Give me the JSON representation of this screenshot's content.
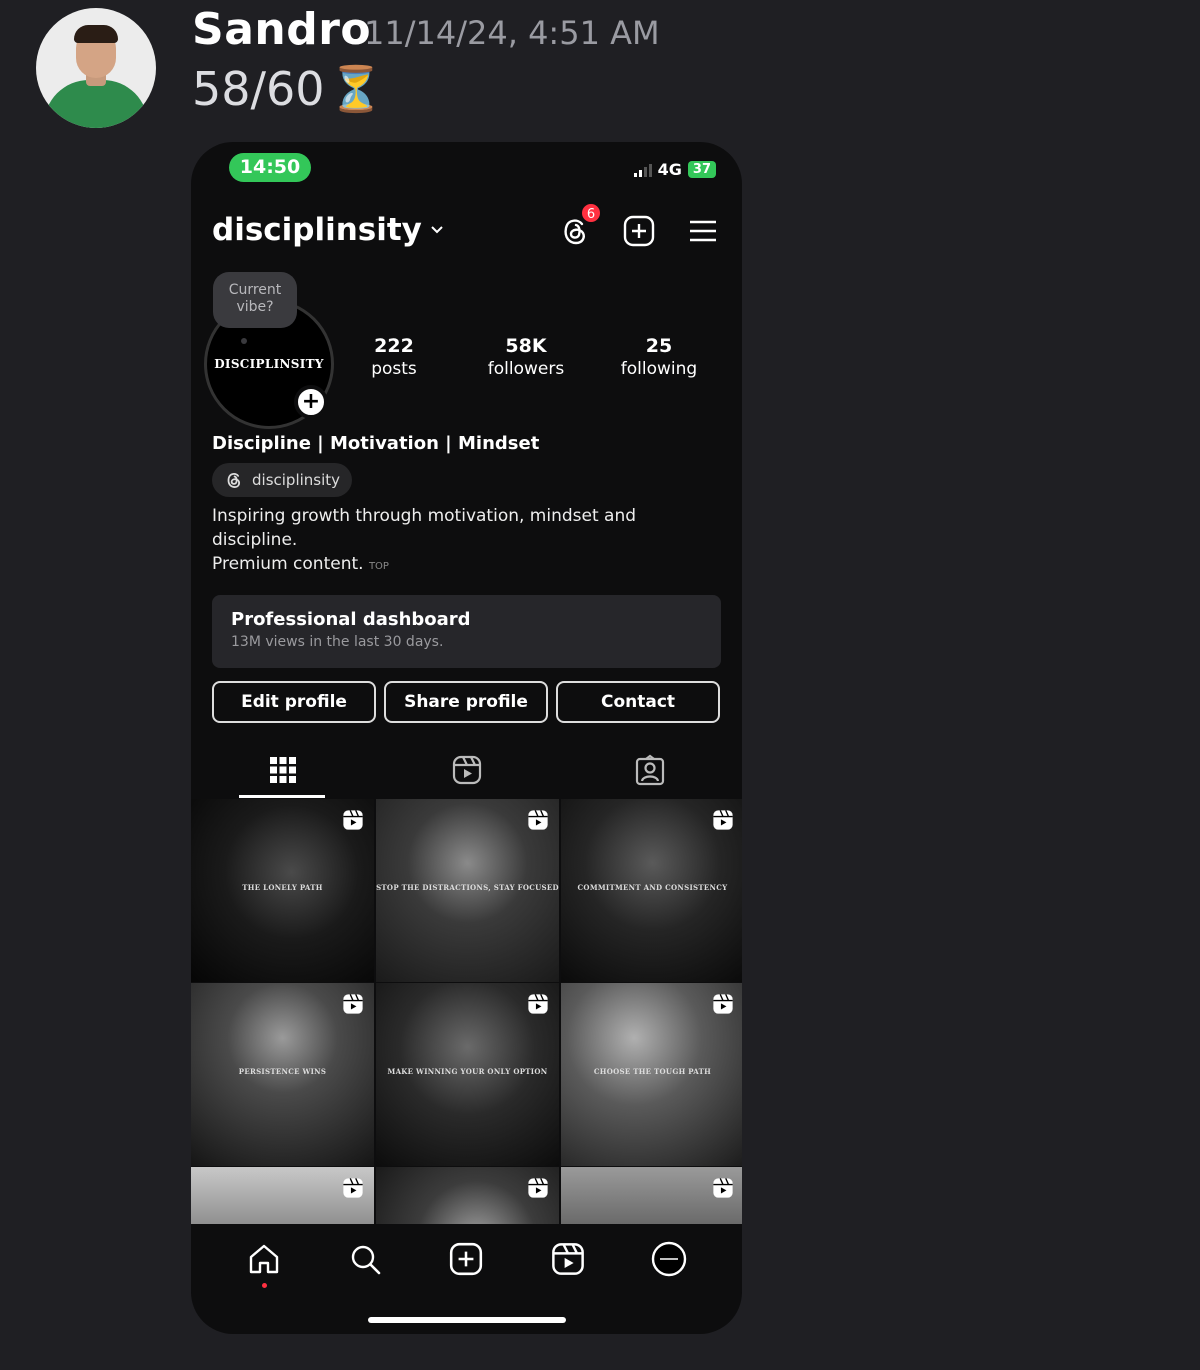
{
  "message": {
    "author": "Sandro",
    "timestamp": "11/14/24, 4:51 AM",
    "text": "58/60",
    "emoji": "⏳"
  },
  "phone": {
    "status_bar": {
      "time": "14:50",
      "network": "4G",
      "battery": "37"
    },
    "header": {
      "username": "disciplinsity",
      "threads_badge_count": "6"
    },
    "profile": {
      "pic_label": "DISCIPLINSITY",
      "vibe_prompt": "Current vibe?",
      "stats": {
        "posts_num": "222",
        "posts_lbl": "posts",
        "followers_num": "58K",
        "followers_lbl": "followers",
        "following_num": "25",
        "following_lbl": "following"
      },
      "bio_name": "Discipline | Motivation | Mindset",
      "threads_handle": "disciplinsity",
      "bio_line1": "Inspiring growth through motivation, mindset and",
      "bio_line2": "discipline.",
      "bio_line3": "Premium content.",
      "top_emoji": "TOP"
    },
    "dashboard": {
      "title": "Professional dashboard",
      "subtitle": "13M views in the last 30 days."
    },
    "buttons": {
      "edit": "Edit profile",
      "share": "Share profile",
      "contact": "Contact"
    },
    "posts": [
      {
        "caption": "THE LONELY PATH"
      },
      {
        "caption": "STOP THE DISTRACTIONS, STAY FOCUSED"
      },
      {
        "caption": "COMMITMENT AND CONSISTENCY"
      },
      {
        "caption": "PERSISTENCE WINS"
      },
      {
        "caption": "MAKE WINNING YOUR ONLY OPTION"
      },
      {
        "caption": "CHOOSE THE TOUGH PATH"
      },
      {
        "caption": ""
      },
      {
        "caption": ""
      },
      {
        "caption": ""
      }
    ],
    "icons": {
      "threads": "threads-icon",
      "add": "plus-square-icon",
      "menu": "hamburger-icon",
      "grid_tab": "grid-icon",
      "reels_tab": "reels-icon",
      "tagged_tab": "tagged-icon",
      "home": "home-icon",
      "search": "search-icon",
      "create": "plus-square-icon",
      "reels": "reels-icon",
      "profile": "profile-avatar-icon"
    },
    "colors": {
      "status_green": "#33c759",
      "notification_red": "#ff3040"
    }
  }
}
